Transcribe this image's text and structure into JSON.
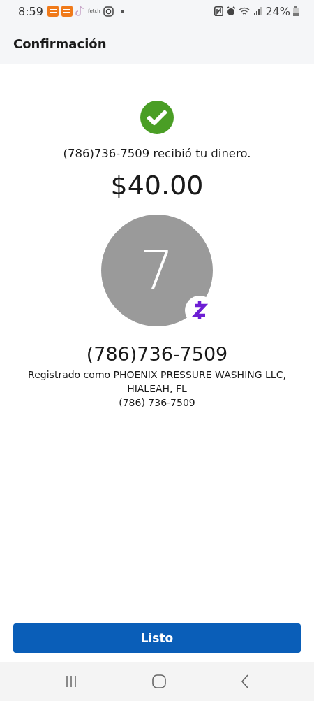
{
  "status_bar": {
    "time": "8:59",
    "fetch_label": "fetch",
    "battery": "24%"
  },
  "header": {
    "title": "Confirmación"
  },
  "confirmation": {
    "message": "(786)736-7509 recibió tu dinero.",
    "amount": "$40.00"
  },
  "recipient": {
    "avatar_initial": "7",
    "name": "(786)736-7509",
    "registered": "Registrado como PHOENIX PRESSURE WASHING LLC, HIALEAH, FL",
    "phone": "(786) 736-7509"
  },
  "buttons": [
    {
      "label": "Listo",
      "kind": "primary"
    }
  ]
}
